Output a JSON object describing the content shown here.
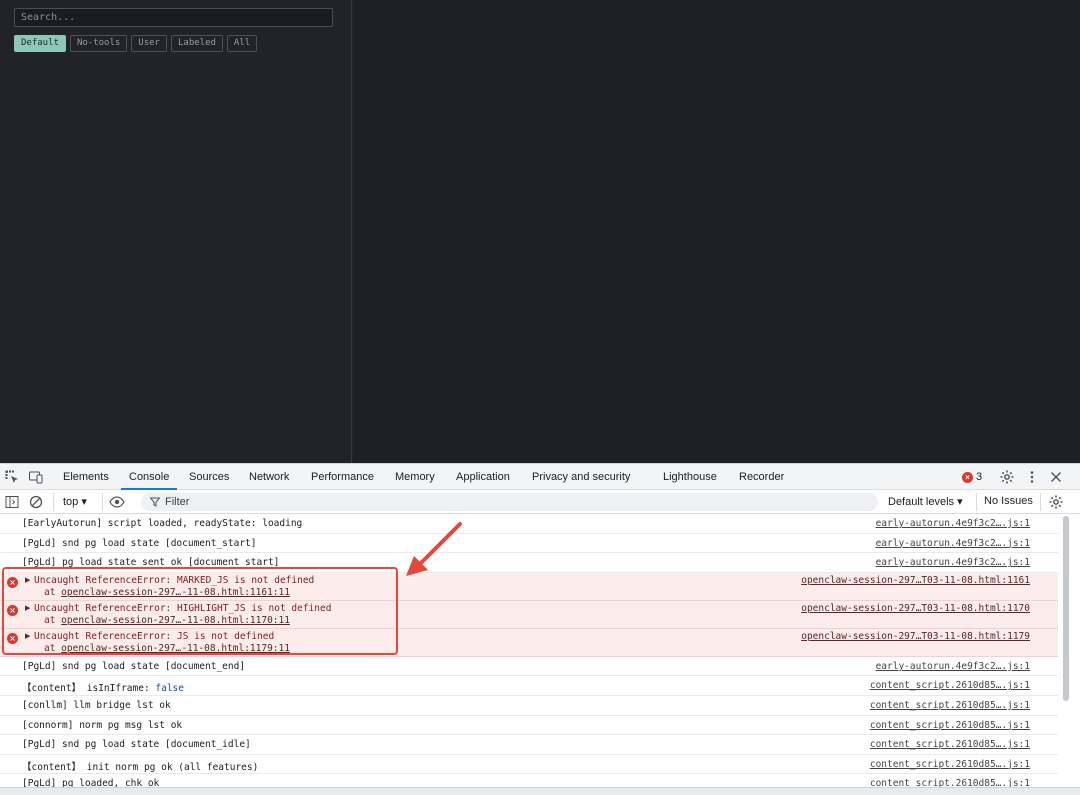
{
  "app": {
    "search_placeholder": "Search...",
    "filters": [
      "Default",
      "No-tools",
      "User",
      "Labeled",
      "All"
    ],
    "active_filter": "Default"
  },
  "devtools": {
    "tabs": [
      "Elements",
      "Console",
      "Sources",
      "Network",
      "Performance",
      "Memory",
      "Application",
      "Privacy and security",
      "Lighthouse",
      "Recorder"
    ],
    "active_tab": "Console",
    "error_count": "3",
    "toolbar": {
      "context": "top ▾",
      "filter_label": "Filter",
      "levels": "Default levels ▾",
      "issues": "No Issues"
    },
    "console_rows": [
      {
        "type": "log",
        "text": "[EarlyAutorun] script loaded, readyState: loading",
        "source": "early-autorun.4e9f3c2….js:1"
      },
      {
        "type": "log",
        "text": "[PgLd] snd pg load state [document_start]",
        "source": "early-autorun.4e9f3c2….js:1"
      },
      {
        "type": "log",
        "text": "[PgLd] pg load state sent ok [document_start]",
        "source": "early-autorun.4e9f3c2….js:1"
      },
      {
        "type": "error",
        "text": "Uncaught ReferenceError: MARKED_JS is not defined",
        "at": "openclaw-session-297…-11-08.html:1161:11",
        "source": "openclaw-session-297…T03-11-08.html:1161"
      },
      {
        "type": "error",
        "text": "Uncaught ReferenceError: HIGHLIGHT_JS is not defined",
        "at": "openclaw-session-297…-11-08.html:1170:11",
        "source": "openclaw-session-297…T03-11-08.html:1170"
      },
      {
        "type": "error",
        "text": "Uncaught ReferenceError: JS is not defined",
        "at": "openclaw-session-297…-11-08.html:1179:11",
        "source": "openclaw-session-297…T03-11-08.html:1179"
      },
      {
        "type": "log",
        "text": "[PgLd] snd pg load state [document_end]",
        "source": "early-autorun.4e9f3c2….js:1"
      },
      {
        "type": "log",
        "text": "【content】 isInIframe: ",
        "value": "false",
        "source": "content_script.2610d85….js:1"
      },
      {
        "type": "log",
        "text": "[conllm] llm bridge lst ok",
        "source": "content_script.2610d85….js:1"
      },
      {
        "type": "log",
        "text": "[connorm] norm pg msg lst ok",
        "source": "content_script.2610d85….js:1"
      },
      {
        "type": "log",
        "text": "[PgLd] snd pg load state [document_idle]",
        "source": "content_script.2610d85….js:1"
      },
      {
        "type": "log",
        "text": "【content】 init norm pg ok (all features)",
        "source": "content_script.2610d85….js:1"
      },
      {
        "type": "log",
        "text": "[PgLd] pg loaded, chk ok",
        "source": "content_script.2610d85….js:1"
      }
    ]
  },
  "annotation": {
    "color": "#e5483a"
  },
  "icons": [
    "inspect-icon",
    "device-toolbar-icon",
    "settings-gear-icon",
    "more-vertical-icon",
    "close-icon",
    "sidebar-toggle-icon",
    "clear-console-icon",
    "eye-icon",
    "filter-icon",
    "console-settings-icon",
    "error-icon",
    "expand-triangle-icon",
    "arrow-annotation"
  ]
}
